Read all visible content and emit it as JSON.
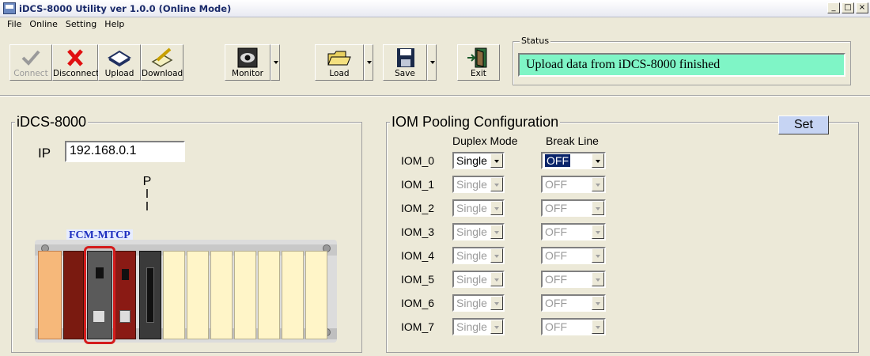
{
  "window": {
    "title": "iDCS-8000 Utility  ver 1.0.0 (Online Mode)",
    "btn_min": "_",
    "btn_max": "□",
    "btn_close": "×"
  },
  "menu": [
    "File",
    "Online",
    "Setting",
    "Help"
  ],
  "toolbar": {
    "connect": "Connect",
    "disconnect": "Disconnect",
    "upload": "Upload",
    "download": "Download",
    "monitor": "Monitor",
    "load": "Load",
    "save": "Save",
    "exit": "Exit"
  },
  "status": {
    "legend": "Status",
    "text": "Upload data from iDCS-8000 finished",
    "bg_color": "#7ff5c6"
  },
  "device_panel": {
    "legend": "iDCS-8000",
    "ip_label": "IP",
    "ip_value": "192.168.0.1",
    "pii_label": [
      "P",
      "I",
      "I"
    ],
    "module_label": "FCM-MTCP"
  },
  "iom_panel": {
    "legend": "IOM Pooling Configuration",
    "set_label": "Set",
    "col_duplex": "Duplex Mode",
    "col_break": "Break Line",
    "rows": [
      {
        "name": "IOM_0",
        "duplex": "Single",
        "break": "OFF",
        "enabled": true
      },
      {
        "name": "IOM_1",
        "duplex": "Single",
        "break": "OFF",
        "enabled": false
      },
      {
        "name": "IOM_2",
        "duplex": "Single",
        "break": "OFF",
        "enabled": false
      },
      {
        "name": "IOM_3",
        "duplex": "Single",
        "break": "OFF",
        "enabled": false
      },
      {
        "name": "IOM_4",
        "duplex": "Single",
        "break": "OFF",
        "enabled": false
      },
      {
        "name": "IOM_5",
        "duplex": "Single",
        "break": "OFF",
        "enabled": false
      },
      {
        "name": "IOM_6",
        "duplex": "Single",
        "break": "OFF",
        "enabled": false
      },
      {
        "name": "IOM_7",
        "duplex": "Single",
        "break": "OFF",
        "enabled": false
      }
    ]
  },
  "colors": {
    "face": "#ece9d8",
    "selection": "#0a246a",
    "module_label": "#1f2fbf",
    "highlight_box": "#d41c1c"
  }
}
